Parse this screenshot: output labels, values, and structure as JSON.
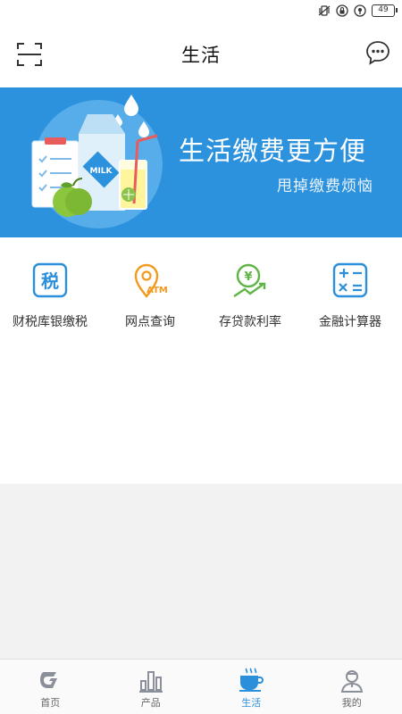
{
  "status_bar": {
    "battery": "49"
  },
  "header": {
    "title": "生活"
  },
  "banner": {
    "title": "生活缴费更方便",
    "subtitle": "甩掉缴费烦恼",
    "milk_label": "MILK",
    "bg_color": "#2c92dd"
  },
  "services": [
    {
      "label": "财税库银缴税",
      "icon": "tax-icon"
    },
    {
      "label": "网点查询",
      "icon": "atm-location-icon"
    },
    {
      "label": "存贷款利率",
      "icon": "interest-rate-icon"
    },
    {
      "label": "金融计算器",
      "icon": "calculator-icon"
    }
  ],
  "bottom_nav": [
    {
      "label": "首页",
      "icon": "home-logo-icon",
      "active": false
    },
    {
      "label": "产品",
      "icon": "products-icon",
      "active": false
    },
    {
      "label": "生活",
      "icon": "coffee-cup-icon",
      "active": true
    },
    {
      "label": "我的",
      "icon": "profile-icon",
      "active": false
    }
  ],
  "colors": {
    "accent": "#2c8fdc",
    "orange": "#f39a1e",
    "green": "#5fb544"
  }
}
